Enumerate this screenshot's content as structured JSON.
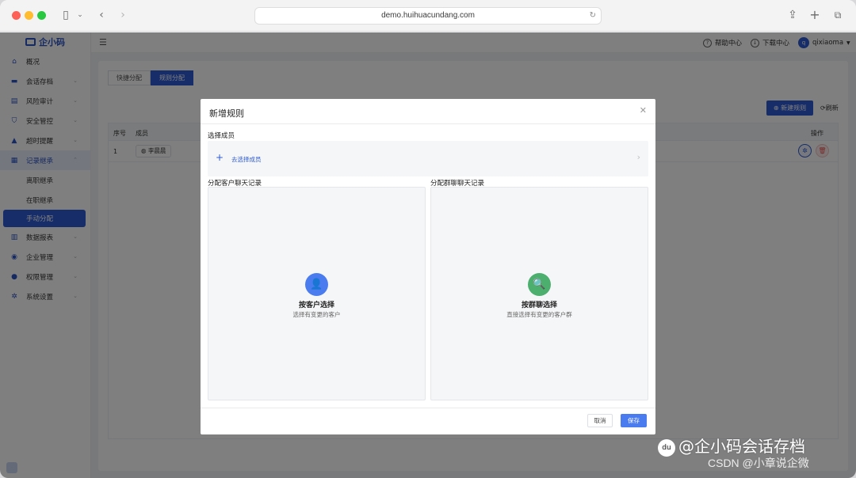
{
  "browser": {
    "url": "demo.huihuacundang.com"
  },
  "app": {
    "logo_text": "企小码"
  },
  "sidebar": {
    "items": [
      {
        "label": "概况",
        "icon": "home-icon"
      },
      {
        "label": "会话存档",
        "icon": "folder-icon"
      },
      {
        "label": "风险审计",
        "icon": "audit-icon"
      },
      {
        "label": "安全管控",
        "icon": "shield-icon"
      },
      {
        "label": "超时提醒",
        "icon": "bell-icon"
      },
      {
        "label": "记录继承",
        "icon": "record-icon"
      },
      {
        "label": "数据报表",
        "icon": "chart-icon"
      },
      {
        "label": "企业管理",
        "icon": "building-icon"
      },
      {
        "label": "权限管理",
        "icon": "lock-icon"
      },
      {
        "label": "系统设置",
        "icon": "gear-icon"
      }
    ],
    "sub_items": [
      "离职继承",
      "在职继承",
      "手动分配"
    ],
    "active_sub": "手动分配"
  },
  "topbar": {
    "help": "帮助中心",
    "download": "下载中心",
    "username": "qixiaoma"
  },
  "page": {
    "tabs": [
      "快捷分配",
      "规则分配"
    ],
    "active_tab": "规则分配",
    "new_rule_button": "新建规则",
    "refresh": "刷新",
    "table": {
      "columns": [
        "序号",
        "成员",
        "操作"
      ],
      "rows": [
        {
          "index": "1",
          "member": "李晨晨"
        }
      ]
    }
  },
  "modal": {
    "title": "新增规则",
    "select_members_label": "选择成员",
    "select_members_link": "去选择成员",
    "customer_section_label": "分配客户聊天记录",
    "group_section_label": "分配群聊聊天记录",
    "customer_option": {
      "title": "按客户选择",
      "desc": "选择有变更的客户",
      "color": "#4a7cf0"
    },
    "group_option": {
      "title": "按群聊选择",
      "desc": "直接选择有变更的客户群",
      "color": "#4caf6e"
    },
    "cancel": "取消",
    "save": "保存"
  },
  "watermark": {
    "main": "@企小码会话存档",
    "sub": "CSDN @小章说企微",
    "logo": "du"
  }
}
